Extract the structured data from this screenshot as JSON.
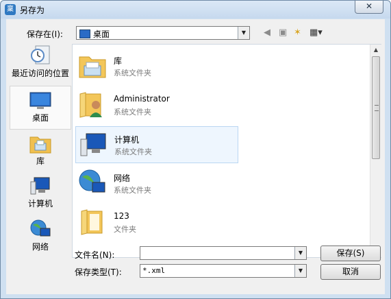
{
  "window": {
    "title": "另存为",
    "app_icon_glyph": "稟",
    "close_glyph": "✕"
  },
  "lookin": {
    "label": "保存在(I):",
    "value": "桌面"
  },
  "places": [
    {
      "label": "最近访问的位置",
      "icon": "recent-places-icon"
    },
    {
      "label": "桌面",
      "icon": "desktop-icon",
      "selected": true
    },
    {
      "label": "库",
      "icon": "library-icon"
    },
    {
      "label": "计算机",
      "icon": "computer-icon"
    },
    {
      "label": "网络",
      "icon": "network-icon"
    }
  ],
  "items": [
    {
      "name": "库",
      "type": "系统文件夹",
      "icon": "library-folder-icon"
    },
    {
      "name": "Administrator",
      "type": "系统文件夹",
      "icon": "user-folder-icon"
    },
    {
      "name": "计算机",
      "type": "系统文件夹",
      "icon": "computer-icon",
      "highlighted": true
    },
    {
      "name": "网络",
      "type": "系统文件夹",
      "icon": "network-icon"
    },
    {
      "name": "123",
      "type": "文件夹",
      "icon": "folder-icon"
    }
  ],
  "filename": {
    "label": "文件名(N):",
    "value": ""
  },
  "filetype": {
    "label": "保存类型(T):",
    "value": "*.xml"
  },
  "buttons": {
    "save": "保存(S)",
    "cancel": "取消"
  }
}
